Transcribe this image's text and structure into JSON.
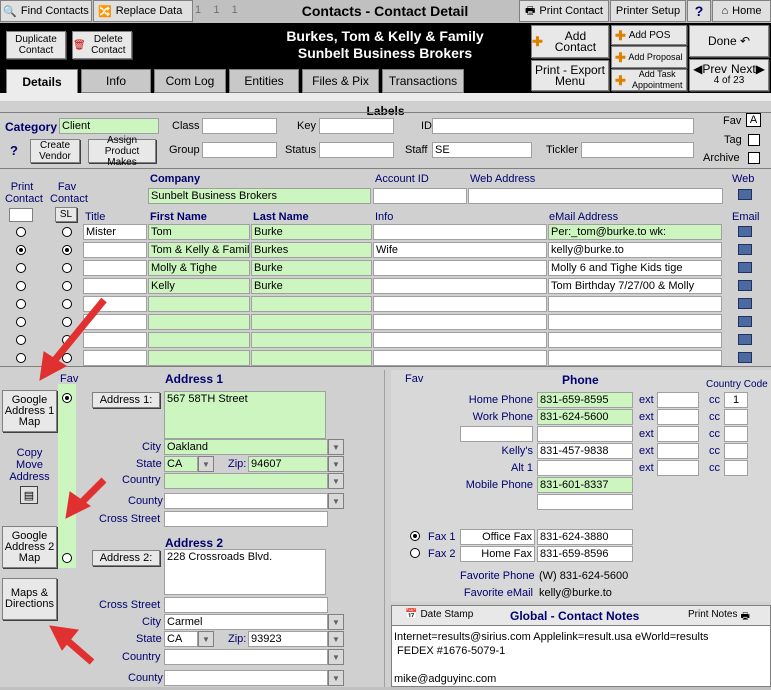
{
  "toolbar": {
    "find_contacts": "Find Contacts",
    "replace_data": "Replace Data",
    "counters": "1    1    1",
    "title": "Contacts - Contact Detail",
    "print_contact": "Print Contact",
    "printer_setup": "Printer Setup",
    "help": "?",
    "home": "Home"
  },
  "header": {
    "duplicate_contact": "Duplicate Contact",
    "delete_contact": "Delete Contact",
    "name_line1": "Burkes, Tom & Kelly & Family",
    "name_line2": "Sunbelt Business Brokers",
    "add_contact": "Add Contact",
    "print_export_menu": "Print - Export Menu",
    "add_pos": "Add POS",
    "add_proposal": "Add Proposal",
    "add_task_appointment": "Add Task Appointment",
    "done": "Done",
    "prev": "Prev",
    "next": "Next",
    "record_pos": "4 of 23"
  },
  "tabs": [
    "Details",
    "Info",
    "Com Log",
    "Entities",
    "Files & Pix",
    "Transactions"
  ],
  "labels_section": {
    "title": "Labels",
    "category_label": "Category",
    "category_value": "Client",
    "class_label": "Class",
    "key_label": "Key",
    "id_label": "ID",
    "group_label": "Group",
    "status_label": "Status",
    "staff_label": "Staff",
    "staff_value": "SE",
    "tickler_label": "Tickler",
    "create_vendor": "Create Vendor",
    "assign_product_makes": "Assign Product Makes",
    "fav_label": "Fav",
    "fav_box": "A",
    "tag_label": "Tag",
    "archive_label": "Archive"
  },
  "contacts": {
    "print_contact_hdr": "Print Contact",
    "fav_contact_hdr": "Fav Contact",
    "sl": "SL",
    "company_hdr": "Company",
    "company_value": "Sunbelt Business Brokers",
    "account_id_hdr": "Account ID",
    "web_address_hdr": "Web Address",
    "web_hdr": "Web",
    "email_hdr": "Email",
    "title_hdr": "Title",
    "first_name_hdr": "First Name",
    "last_name_hdr": "Last Name",
    "info_hdr": "Info",
    "email_address_hdr": "eMail Address",
    "rows": [
      {
        "title": "Mister",
        "first": "Tom",
        "last": "Burke",
        "info": "",
        "email": "Per:_tom@burke.to      wk:"
      },
      {
        "title": "",
        "first": "Tom & Kelly & Family",
        "last": "Burkes",
        "info": "Wife",
        "email": "kelly@burke.to"
      },
      {
        "title": "",
        "first": "Molly & Tighe",
        "last": "Burke",
        "info": "",
        "email": "Molly 6 and Tighe   Kids  tige"
      },
      {
        "title": "",
        "first": "Kelly",
        "last": "Burke",
        "info": "",
        "email": "Tom Birthday 7/27/00 & Molly"
      },
      {
        "title": "",
        "first": "",
        "last": "",
        "info": "",
        "email": ""
      },
      {
        "title": "",
        "first": "",
        "last": "",
        "info": "",
        "email": ""
      },
      {
        "title": "",
        "first": "",
        "last": "",
        "info": "",
        "email": ""
      },
      {
        "title": "",
        "first": "",
        "last": "",
        "info": "",
        "email": ""
      }
    ]
  },
  "address": {
    "fav_label": "Fav",
    "google_address_1": "Google Address 1 Map",
    "copy_move_address": "Copy Move Address",
    "google_address_2": "Google Address 2 Map",
    "maps_directions": "Maps & Directions",
    "address1_title": "Address 1",
    "address1_btn": "Address 1:",
    "address1_value": "567 58TH Street",
    "city_label": "City",
    "city1": "Oakland",
    "state_label": "State",
    "state1": "CA",
    "zip_label": "Zip:",
    "zip1": "94607",
    "country_label": "Country",
    "county_label": "County",
    "cross_street_label": "Cross Street",
    "address2_title": "Address 2",
    "address2_btn": "Address 2:",
    "address2_value": "228 Crossroads Blvd.",
    "city2": "Carmel",
    "state2": "CA",
    "zip2": "93923"
  },
  "phone": {
    "fav_label": "Fav",
    "title": "Phone",
    "country_code_label": "Country Code",
    "ext_label": "ext",
    "cc_label": "cc",
    "rows": [
      {
        "label": "Home Phone",
        "value": "831-659-8595",
        "cc": "1",
        "green": true
      },
      {
        "label": "Work Phone",
        "value": "831-624-5600",
        "cc": "",
        "green": true
      },
      {
        "label": "",
        "value": "",
        "cc": "",
        "green": false
      },
      {
        "label": "Kelly's",
        "value": "831-457-9838",
        "cc": "",
        "green": false
      },
      {
        "label": "Alt 1",
        "value": "",
        "cc": "",
        "green": false
      },
      {
        "label": "Mobile Phone",
        "value": "831-601-8337",
        "cc": "",
        "green": true
      },
      {
        "label": "",
        "value": "",
        "cc": "",
        "green": false
      }
    ],
    "fax1_label": "Fax 1",
    "fax1_name": "Office Fax",
    "fax1_value": "831-624-3880",
    "fax2_label": "Fax 2",
    "fax2_name": "Home Fax",
    "fax2_value": "831-659-8596",
    "favorite_phone_label": "Favorite Phone",
    "favorite_phone_value": "(W) 831-624-5600",
    "favorite_email_label": "Favorite eMail",
    "favorite_email_value": "kelly@burke.to"
  },
  "notes": {
    "date_stamp": "Date Stamp",
    "title": "Global - Contact Notes",
    "print_notes": "Print Notes",
    "line1": "Internet=results@sirius.com  Applelink=result.usa  eWorld=results",
    "line2": " FEDEX #1676-5079-1",
    "line3": "mike@adguyinc.com"
  },
  "colors": {
    "arrow": "#e03030",
    "green_field": "#ccf5c0",
    "header_bg": "#000000"
  }
}
